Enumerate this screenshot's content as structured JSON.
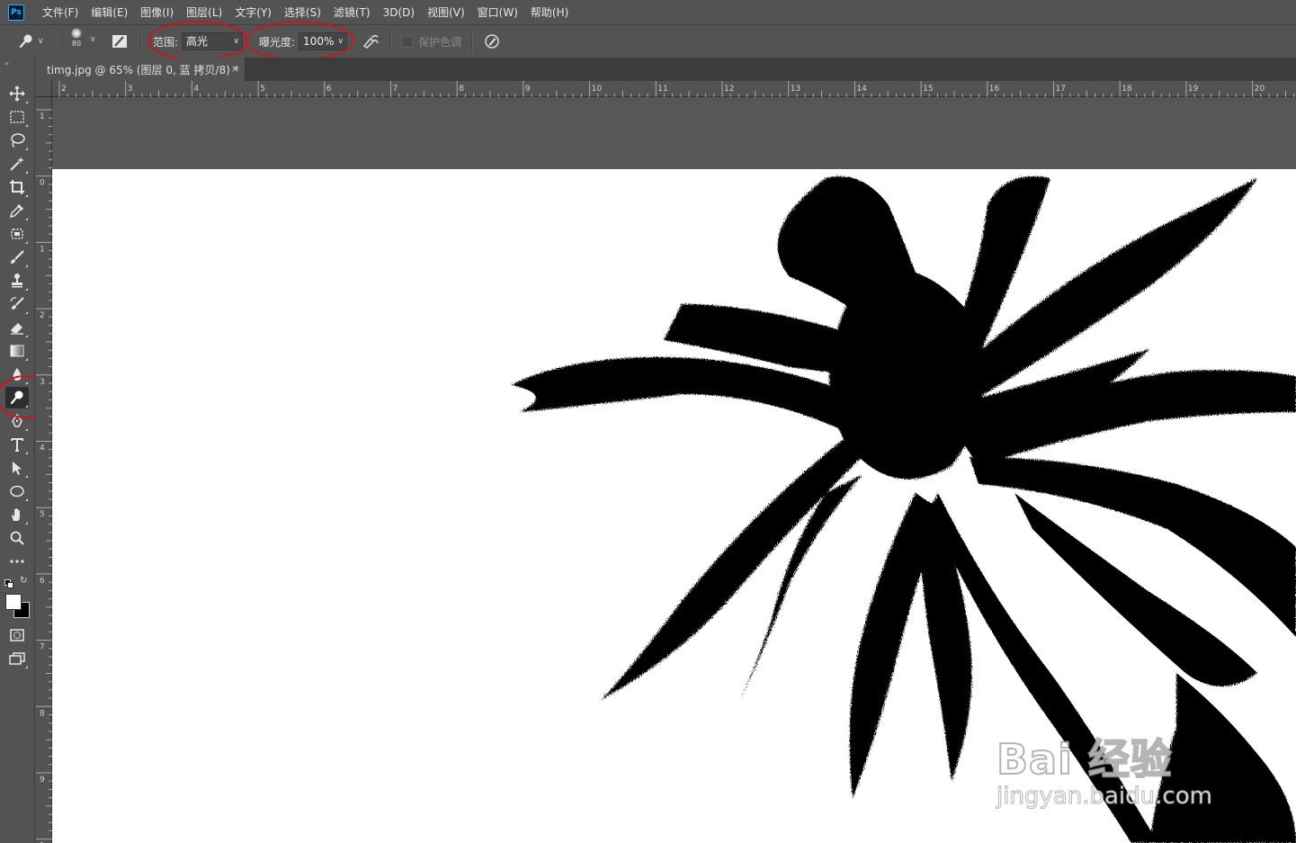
{
  "app": {
    "logo": "Ps"
  },
  "menu": [
    "文件(F)",
    "编辑(E)",
    "图像(I)",
    "图层(L)",
    "文字(Y)",
    "选择(S)",
    "滤镜(T)",
    "3D(D)",
    "视图(V)",
    "窗口(W)",
    "帮助(H)"
  ],
  "options": {
    "tool_icon": "dodge-burn-icon",
    "brush_size": "80",
    "range_label": "范围:",
    "range_value": "高光",
    "exposure_label": "曝光度:",
    "exposure_value": "100%",
    "protect_tones_label": "保护色调",
    "protect_tones_checked": false,
    "annotation_color": "#c8161d"
  },
  "document": {
    "tab_title": "timg.jpg @ 65% (图层 0, 蓝 拷贝/8) *",
    "close_glyph": "×"
  },
  "rulers": {
    "top_labels": [
      "2",
      "3",
      "4",
      "5",
      "6",
      "7",
      "8",
      "9",
      "10",
      "11",
      "12",
      "13",
      "14",
      "15",
      "16",
      "17",
      "18",
      "19",
      "20"
    ],
    "left_labels": [
      "1",
      "0",
      "1",
      "2",
      "3",
      "4",
      "5",
      "6",
      "7",
      "8",
      "9",
      "1"
    ]
  },
  "toolbar": {
    "tools": [
      "move-icon",
      "marquee-icon",
      "lasso-icon",
      "magic-wand-icon",
      "crop-icon",
      "eyedropper-icon",
      "healing-icon",
      "brush-icon",
      "stamp-icon",
      "history-brush-icon",
      "eraser-icon",
      "gradient-icon",
      "blur-icon",
      "dodge-icon",
      "pen-icon",
      "type-icon",
      "path-select-icon",
      "ellipse-icon",
      "hand-icon",
      "zoom-icon",
      "more-icon"
    ],
    "active_tool": "dodge-icon",
    "foreground_color": "#ffffff",
    "background_color": "#000000"
  },
  "watermark": {
    "main": "Bai 经验",
    "sub": "jingyan.baidu.com"
  }
}
